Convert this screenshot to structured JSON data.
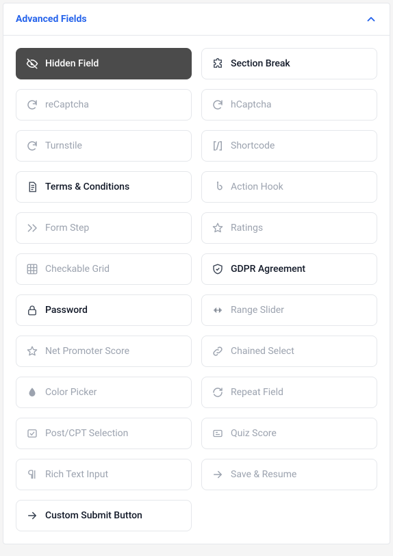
{
  "section": {
    "title": "Advanced Fields"
  },
  "fields": [
    {
      "id": "hidden-field",
      "label": "Hidden Field",
      "icon": "eye-off",
      "state": "selected"
    },
    {
      "id": "section-break",
      "label": "Section Break",
      "icon": "puzzle",
      "state": "active"
    },
    {
      "id": "recaptcha",
      "label": "reCaptcha",
      "icon": "refresh",
      "state": "disabled"
    },
    {
      "id": "hcaptcha",
      "label": "hCaptcha",
      "icon": "refresh",
      "state": "disabled"
    },
    {
      "id": "turnstile",
      "label": "Turnstile",
      "icon": "refresh",
      "state": "disabled"
    },
    {
      "id": "shortcode",
      "label": "Shortcode",
      "icon": "brackets",
      "state": "disabled"
    },
    {
      "id": "terms",
      "label": "Terms & Conditions",
      "icon": "document",
      "state": "active"
    },
    {
      "id": "action-hook",
      "label": "Action Hook",
      "icon": "hook",
      "state": "disabled"
    },
    {
      "id": "form-step",
      "label": "Form Step",
      "icon": "forward",
      "state": "disabled"
    },
    {
      "id": "ratings",
      "label": "Ratings",
      "icon": "star",
      "state": "disabled"
    },
    {
      "id": "checkable-grid",
      "label": "Checkable Grid",
      "icon": "grid",
      "state": "disabled"
    },
    {
      "id": "gdpr",
      "label": "GDPR Agreement",
      "icon": "shield",
      "state": "active"
    },
    {
      "id": "password",
      "label": "Password",
      "icon": "lock",
      "state": "active"
    },
    {
      "id": "range-slider",
      "label": "Range Slider",
      "icon": "slider",
      "state": "disabled"
    },
    {
      "id": "nps",
      "label": "Net Promoter Score",
      "icon": "star",
      "state": "disabled"
    },
    {
      "id": "chained-select",
      "label": "Chained Select",
      "icon": "link",
      "state": "disabled"
    },
    {
      "id": "color-picker",
      "label": "Color Picker",
      "icon": "droplet",
      "state": "disabled"
    },
    {
      "id": "repeat-field",
      "label": "Repeat Field",
      "icon": "repeat",
      "state": "disabled"
    },
    {
      "id": "post-cpt",
      "label": "Post/CPT Selection",
      "icon": "select-box",
      "state": "disabled"
    },
    {
      "id": "quiz-score",
      "label": "Quiz Score",
      "icon": "score",
      "state": "disabled"
    },
    {
      "id": "rich-text",
      "label": "Rich Text Input",
      "icon": "paragraph",
      "state": "disabled"
    },
    {
      "id": "save-resume",
      "label": "Save & Resume",
      "icon": "arrow-right",
      "state": "disabled"
    },
    {
      "id": "custom-submit",
      "label": "Custom Submit Button",
      "icon": "arrow-right",
      "state": "active"
    }
  ]
}
